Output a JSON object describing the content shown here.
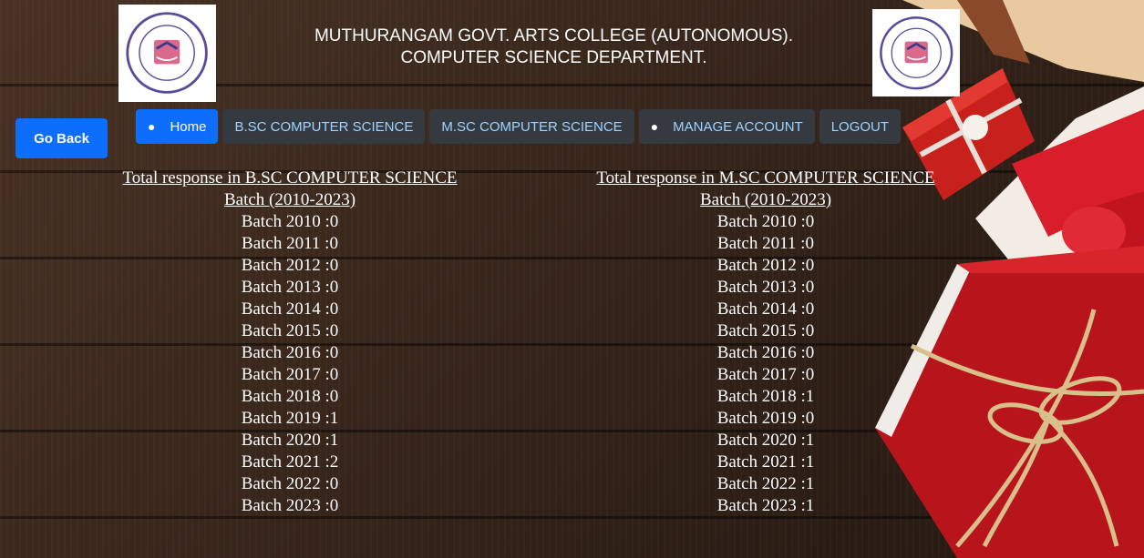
{
  "header": {
    "title_line1": "MUTHURANGAM GOVT. ARTS COLLEGE (AUTONOMOUS).",
    "title_line2": "COMPUTER SCIENCE DEPARTMENT."
  },
  "logos": {
    "left_icon": "college-seal-icon",
    "right_icon": "college-seal-icon"
  },
  "go_back_label": "Go Back",
  "nav": {
    "home": "Home",
    "bsc": "B.SC COMPUTER SCIENCE",
    "msc": "M.SC COMPUTER SCIENCE",
    "manage": "MANAGE ACCOUNT",
    "logout": "LOGOUT"
  },
  "colors": {
    "primary": "#0d6efd",
    "nav_bg": "#343a40",
    "nav_text": "#9fd3ff"
  },
  "bsc": {
    "heading": "Total response in B.SC COMPUTER SCIENCE",
    "range": "Batch (2010-2023)",
    "batches": [
      "Batch 2010 :0",
      "Batch 2011 :0",
      "Batch 2012 :0",
      "Batch 2013 :0",
      "Batch 2014 :0",
      "Batch 2015 :0",
      "Batch 2016 :0",
      "Batch 2017 :0",
      "Batch 2018 :0",
      "Batch 2019 :1",
      "Batch 2020 :1",
      "Batch 2021 :2",
      "Batch 2022 :0",
      "Batch 2023 :0"
    ]
  },
  "msc": {
    "heading": "Total response in M.SC COMPUTER SCIENCE",
    "range": "Batch (2010-2023)",
    "batches": [
      "Batch 2010 :0",
      "Batch 2011 :0",
      "Batch 2012 :0",
      "Batch 2013 :0",
      "Batch 2014 :0",
      "Batch 2015 :0",
      "Batch 2016 :0",
      "Batch 2017 :0",
      "Batch 2018 :1",
      "Batch 2019 :0",
      "Batch 2020 :1",
      "Batch 2021 :1",
      "Batch 2022 :1",
      "Batch 2023 :1"
    ]
  }
}
